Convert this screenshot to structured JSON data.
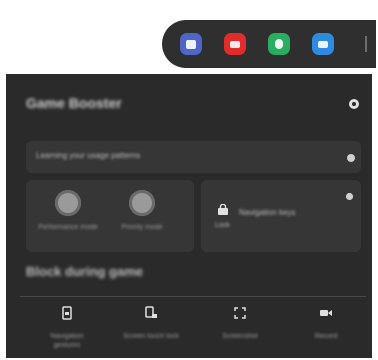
{
  "app_bar": {
    "apps": [
      {
        "icon": "meeting-app-icon",
        "color": "#4f66c9"
      },
      {
        "icon": "youtube-icon",
        "color": "#e22b2b"
      },
      {
        "icon": "messenger-app-icon",
        "color": "#27ae60"
      },
      {
        "icon": "chat-app-icon",
        "color": "#2f8be0"
      }
    ]
  },
  "panel": {
    "title": "Game Booster",
    "hint_text": "Learning your usage patterns",
    "toggles": [
      {
        "label": "Performance mode"
      },
      {
        "label": "Priority mode"
      }
    ],
    "lock_label": "Lock",
    "lock_value": "Navigation keys",
    "block_title": "Block during game",
    "bottom": [
      {
        "label": "Navigation gestures",
        "icon": "screen-lock-icon"
      },
      {
        "label": "Screen touch lock",
        "icon": "touch-lock-icon"
      },
      {
        "label": "Screenshot",
        "icon": "screenshot-icon"
      },
      {
        "label": "Record",
        "icon": "record-icon"
      }
    ]
  }
}
